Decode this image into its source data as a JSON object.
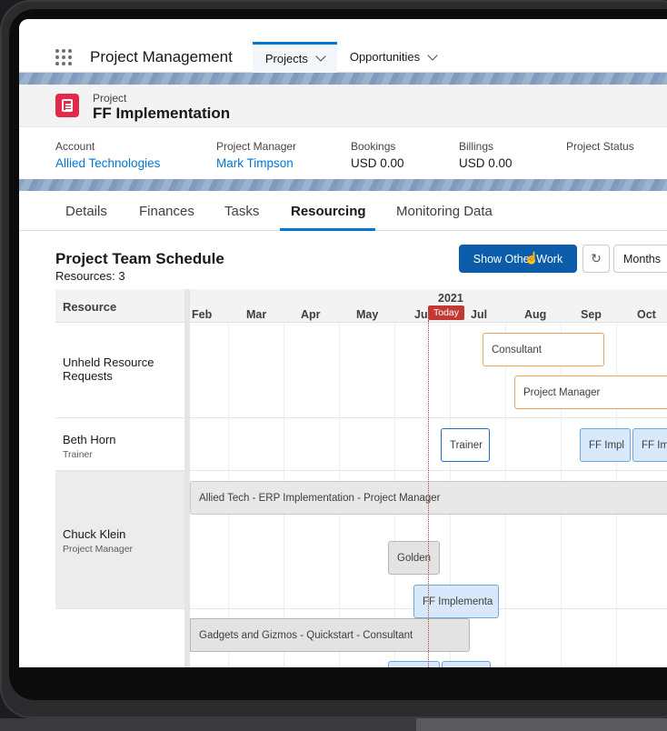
{
  "nav": {
    "app_name": "Project Management",
    "tabs": [
      {
        "label": "Projects",
        "active": true
      },
      {
        "label": "Opportunities",
        "active": false
      }
    ]
  },
  "record": {
    "type": "Project",
    "title": "FF Implementation"
  },
  "highlights": [
    {
      "label": "Account",
      "value": "Allied Technologies",
      "link": true
    },
    {
      "label": "Project Manager",
      "value": "Mark Timpson",
      "link": true
    },
    {
      "label": "Bookings",
      "value": "USD 0.00",
      "link": false
    },
    {
      "label": "Billings",
      "value": "USD 0.00",
      "link": false
    },
    {
      "label": "Project Status",
      "value": "",
      "link": false
    }
  ],
  "tabs": [
    "Details",
    "Finances",
    "Tasks",
    "Resourcing",
    "Monitoring Data"
  ],
  "active_tab": "Resourcing",
  "schedule": {
    "title": "Project Team Schedule",
    "resources_count": "Resources: 3",
    "show_other_work": "Show Other Work",
    "refresh_icon": "refresh-icon",
    "view_select": "Months",
    "resource_header": "Resource",
    "year": "2021",
    "today_label": "Today",
    "months": [
      "Feb",
      "Mar",
      "Apr",
      "May",
      "Ju",
      "Jul",
      "Aug",
      "Sep",
      "Oct"
    ],
    "resources": [
      {
        "name": "Unheld Resource Requests",
        "role": ""
      },
      {
        "name": "Beth Horn",
        "role": "Trainer"
      },
      {
        "name": "Chuck Klein",
        "role": "Project Manager"
      },
      {
        "name": "",
        "role": ""
      }
    ],
    "bars": {
      "consultant": "Consultant",
      "project_manager": "Project Manager",
      "trainer": "Trainer",
      "ff_impl_1": "FF Impl",
      "ff_impl_2": "FF Im",
      "allied_span": "Allied Tech - ERP Implementation - Project Manager",
      "golden": "Golden",
      "ff_implementa": "FF Implementa",
      "gadgets_span": "Gadgets and Gizmos - Quickstart - Consultant"
    }
  },
  "colors": {
    "brand_blue": "#0176d3",
    "primary_button": "#0b5cab",
    "today_red": "#c23934",
    "record_icon": "#e3294a",
    "request_orange": "#f0a15a",
    "assignment_blue": "#d8e9fb"
  }
}
